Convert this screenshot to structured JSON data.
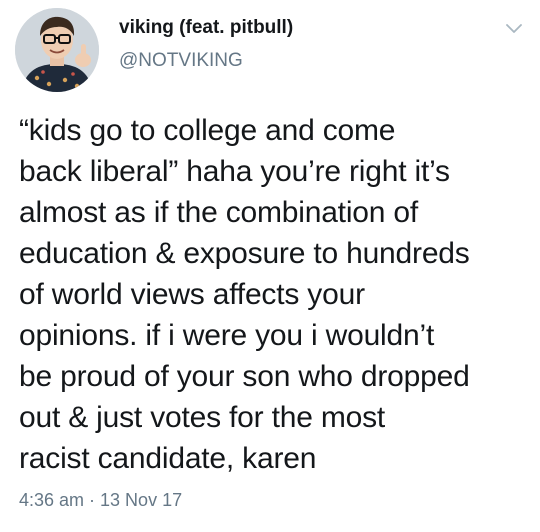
{
  "tweet": {
    "author": {
      "display_name": "viking (feat. pitbull)",
      "handle": "@NOTVIKING",
      "avatar_icon": "profile-photo"
    },
    "menu_icon": "chevron-down-icon",
    "text": "“kids go to college and come\nback liberal” haha you’re right it’s\nalmost as if the combination of\neducation & exposure to hundreds\nof world views affects your\nopinions. if i were you i wouldn’t\nbe proud of your son who dropped\nout & just votes for the most\nracist candidate, karen",
    "timestamp": "4:36 am · 13 Nov 17"
  },
  "colors": {
    "text": "#14171a",
    "secondary": "#657786",
    "chevron": "#aab8c2",
    "background": "#ffffff"
  }
}
